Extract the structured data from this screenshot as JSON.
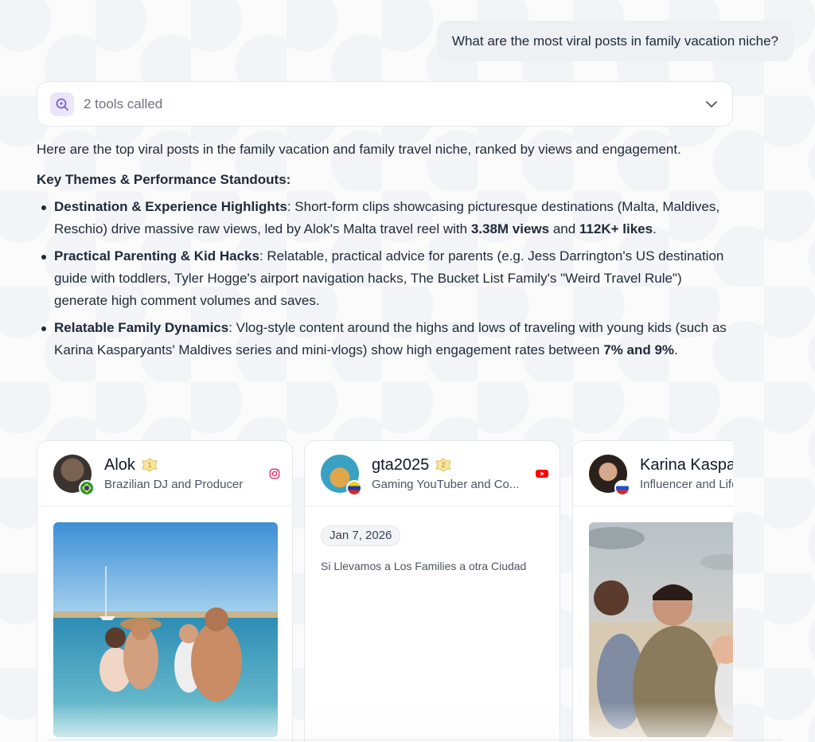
{
  "user_message": "What are the most viral posts in family vacation niche?",
  "tools": {
    "label": "2 tools called"
  },
  "answer": {
    "intro": "Here are the top viral posts in the family vacation and family travel niche, ranked by views and engagement.",
    "heading": "Key Themes & Performance Standouts:",
    "bullets": [
      {
        "title": "Destination & Experience Highlights",
        "text1": ": Short-form clips showcasing picturesque destinations (Malta, Maldives, Reschio) drive massive raw views, led by Alok's Malta travel reel with ",
        "bold1": "3.38M views",
        "text2": " and ",
        "bold2": "112K+ likes",
        "text3": "."
      },
      {
        "title": "Practical Parenting & Kid Hacks",
        "text1": ": Relatable, practical advice for parents (e.g. Jess Darrington's US destination guide with toddlers, Tyler Hogge's airport navigation hacks, The Bucket List Family's \"Weird Travel Rule\") generate high comment volumes and saves."
      },
      {
        "title": "Relatable Family Dynamics",
        "text1": ": Vlog-style content around the highs and lows of traveling with young kids (such as Karina Kasparyants' Maldives series and mini-vlogs) show high engagement rates between ",
        "bold1": "7% and 9%",
        "text2": "."
      }
    ]
  },
  "cards": [
    {
      "name": "Alok",
      "desc": "Brazilian DJ and Producer",
      "rank": "1",
      "platform": "instagram-icon",
      "flag": "brazil"
    },
    {
      "name": "gta2025",
      "desc": "Gaming YouTuber and Co...",
      "rank": "2",
      "platform": "youtube-icon",
      "flag": "venezuela",
      "date": "Jan 7, 2026",
      "text": "Si Llevamos a Los Families a otra Ciudad"
    },
    {
      "name": "Karina Kasparyants",
      "desc": "Influencer and Lifestyle",
      "flag": "russia"
    }
  ],
  "colors": {
    "accent": "#7c5cd6",
    "instagram": "#e1306c",
    "youtube": "#ff0000"
  }
}
